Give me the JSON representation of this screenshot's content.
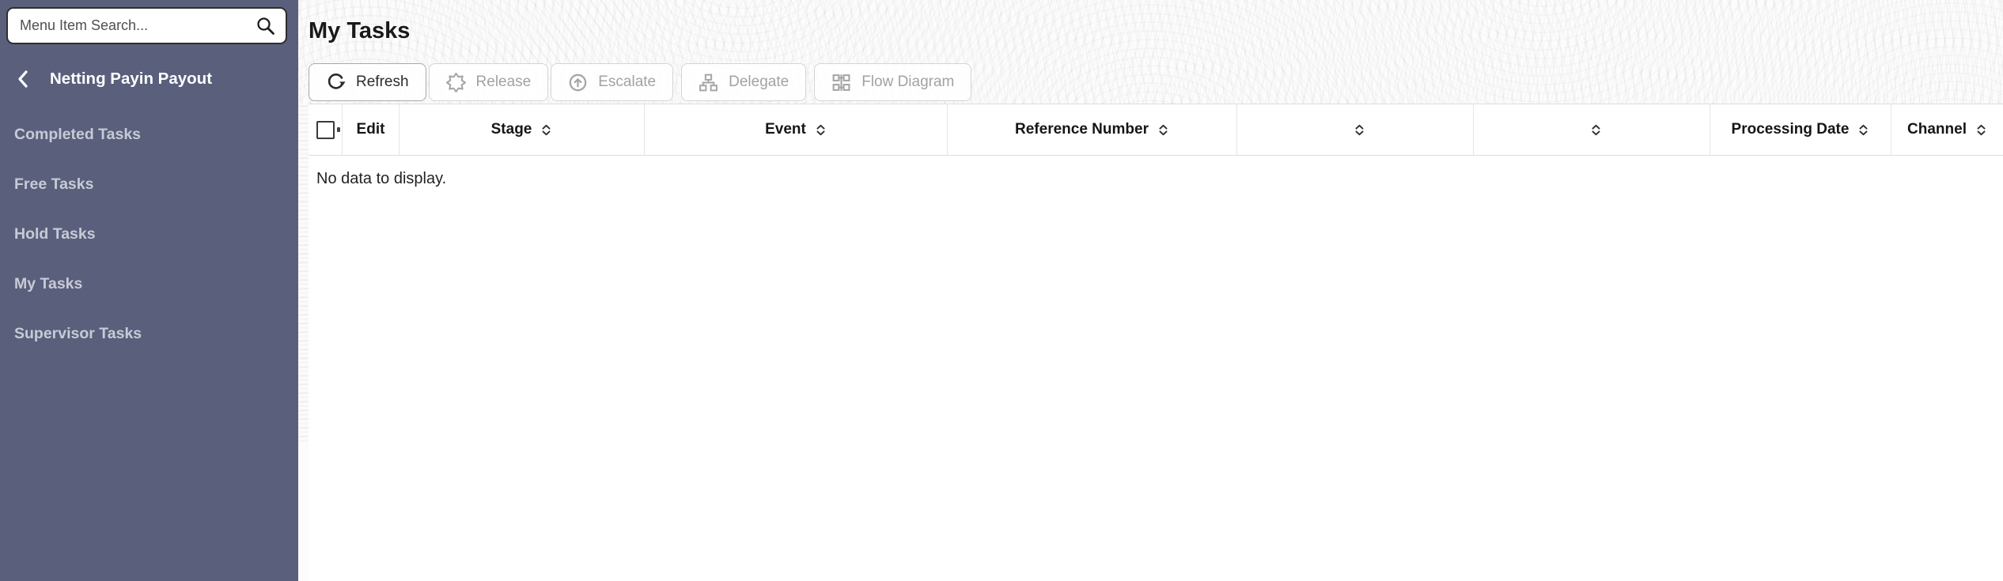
{
  "sidebar": {
    "search_placeholder": "Menu Item Search...",
    "title": "Netting Payin Payout",
    "items": [
      {
        "label": "Completed Tasks"
      },
      {
        "label": "Free Tasks"
      },
      {
        "label": "Hold Tasks"
      },
      {
        "label": "My Tasks"
      },
      {
        "label": "Supervisor Tasks"
      }
    ]
  },
  "main": {
    "title": "My Tasks",
    "toolbar": [
      {
        "label": "Refresh",
        "icon": "refresh-icon",
        "enabled": true
      },
      {
        "label": "Release",
        "icon": "release-burst-icon",
        "enabled": false
      },
      {
        "label": "Escalate",
        "icon": "escalate-up-arrow-icon",
        "enabled": false
      },
      {
        "label": "Delegate",
        "icon": "delegate-hierarchy-icon",
        "enabled": false
      },
      {
        "label": "Flow Diagram",
        "icon": "flow-diagram-icon",
        "enabled": false
      }
    ],
    "table": {
      "columns": [
        {
          "label": "",
          "type": "select-all-checkbox",
          "sortable": false
        },
        {
          "label": "Edit",
          "sortable": false
        },
        {
          "label": "Stage",
          "sortable": true
        },
        {
          "label": "Event",
          "sortable": true
        },
        {
          "label": "Reference Number",
          "sortable": true
        },
        {
          "label": "",
          "sortable": true
        },
        {
          "label": "",
          "sortable": true
        },
        {
          "label": "Processing Date",
          "sortable": true
        },
        {
          "label": "Channel",
          "sortable": true
        }
      ],
      "rows": [],
      "empty_message": "No data to display."
    }
  },
  "colors": {
    "sidebar_bg": "#5A5F7C",
    "sidebar_text": "#C7CBD6",
    "sidebar_title_text": "#FFFFFF",
    "enabled_button_text": "#2B2B2B",
    "disabled_button_text": "#A2A2A2",
    "table_border": "#E2E2E2",
    "header_text": "#161616"
  }
}
